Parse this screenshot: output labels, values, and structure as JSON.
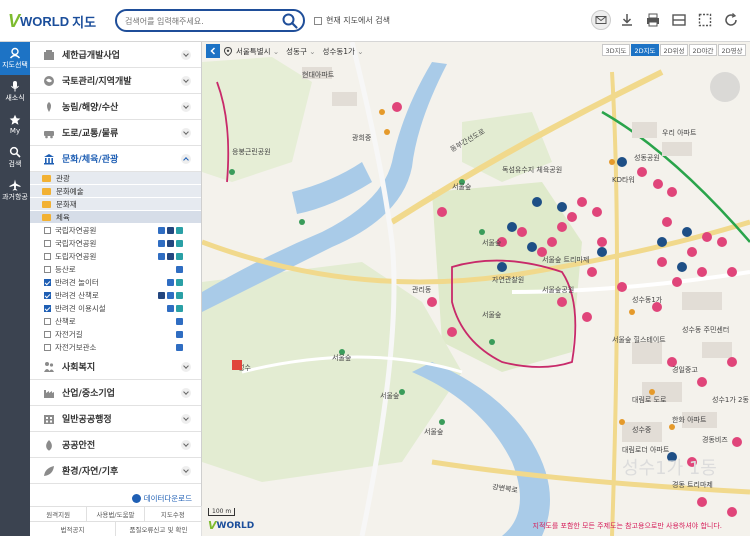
{
  "header": {
    "logo_v": "V",
    "logo_w": "WORLD",
    "logo_k": "지도",
    "search_placeholder": "검색어를 입력해주세요.",
    "map_scope_label": "현재 지도에서 검색"
  },
  "rail": {
    "items": [
      {
        "label": "지도선택",
        "icon": "map-select-icon"
      },
      {
        "label": "새소식",
        "icon": "microphone-icon"
      },
      {
        "label": "My",
        "icon": "star-icon"
      },
      {
        "label": "검색",
        "icon": "search-icon"
      },
      {
        "label": "과거항공",
        "icon": "airplane-icon"
      }
    ]
  },
  "panel": {
    "categories_top": [
      {
        "label": "세한급개발사업",
        "icon": "development-icon"
      },
      {
        "label": "국토관리/지역개발",
        "icon": "land-icon"
      },
      {
        "label": "농림/해양/수산",
        "icon": "agriculture-icon"
      },
      {
        "label": "도로/교통/물류",
        "icon": "traffic-icon"
      }
    ],
    "open_category": {
      "label": "문화/체육/관광",
      "icon": "culture-icon"
    },
    "subfolders": [
      {
        "label": "관광"
      },
      {
        "label": "문화예술"
      },
      {
        "label": "문화재"
      },
      {
        "label": "체육"
      }
    ],
    "layers": [
      {
        "label": "국립자연공원",
        "checked": false,
        "badges": [
          "blue",
          "navy",
          "teal"
        ]
      },
      {
        "label": "국립자연공원",
        "checked": false,
        "badges": [
          "blue",
          "navy",
          "teal"
        ]
      },
      {
        "label": "도립자연공원",
        "checked": false,
        "badges": [
          "blue",
          "navy",
          "teal"
        ]
      },
      {
        "label": "등산로",
        "checked": false,
        "badges": [
          "blue"
        ]
      },
      {
        "label": "반려견 놀이터",
        "checked": true,
        "badges": [
          "blue",
          "teal"
        ]
      },
      {
        "label": "반려견 산책로",
        "checked": true,
        "badges": [
          "navy",
          "blue",
          "teal"
        ]
      },
      {
        "label": "반려견 이용시설",
        "checked": true,
        "badges": [
          "blue",
          "teal"
        ]
      },
      {
        "label": "산책로",
        "checked": false,
        "badges": [
          "blue"
        ]
      },
      {
        "label": "자전거길",
        "checked": false,
        "badges": [
          "blue"
        ]
      },
      {
        "label": "자전거보관소",
        "checked": false,
        "badges": [
          "blue"
        ]
      }
    ],
    "categories_bottom": [
      {
        "label": "사회복지",
        "icon": "welfare-icon"
      },
      {
        "label": "산업/중소기업",
        "icon": "industry-icon"
      },
      {
        "label": "일반공공행정",
        "icon": "admin-icon"
      },
      {
        "label": "공공안전",
        "icon": "safety-icon"
      },
      {
        "label": "환경/자연/기후",
        "icon": "environment-icon"
      }
    ],
    "download_label": "데이터다운로드",
    "footer_row1": [
      "원격지원",
      "사용법/도움말",
      "지도수정"
    ],
    "footer_row2": [
      "법적공지",
      "품질오류신고 및 확인"
    ]
  },
  "map": {
    "breadcrumbs": [
      "서울특별시",
      "성동구",
      "성수동1가"
    ],
    "view_tabs": [
      "3D지도",
      "2D지도",
      "2D위성",
      "2D야간",
      "2D영상"
    ],
    "active_tab": "2D지도",
    "scale_label": "100 m",
    "disclaimer": "지적도를 포함한 모든 주제도는 참고용으로만 사용하셔야 합니다.",
    "place_labels": [
      "서울숲",
      "서울숲",
      "서울숲",
      "서울숲",
      "서울숲",
      "서울숲",
      "KD타워",
      "성동공원",
      "독섬유수지 체육공원",
      "우리 아파트",
      "대림로 도로",
      "강변북로",
      "동부간선도로",
      "서울숲공원",
      "자연관찰원",
      "성수동 주민센터",
      "한화 아파트",
      "서울숲 힐스테이트",
      "경일중고",
      "성수중",
      "대림로더 아파트",
      "성수1가 2동",
      "경동비즈",
      "관리동",
      "경동 트리마제",
      "서울숲 트리마제",
      "광희중",
      "현대아파트",
      "성수동1가",
      "성수",
      "응봉근린공원"
    ],
    "watermark": "성수1가 1동"
  }
}
